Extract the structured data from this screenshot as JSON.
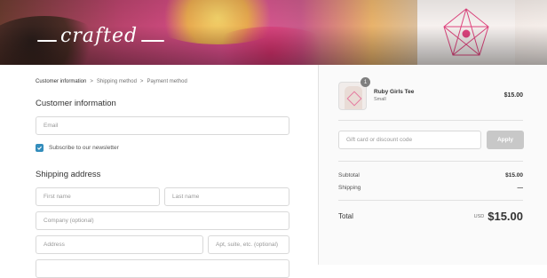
{
  "banner": {
    "logo_text": "crafted"
  },
  "breadcrumb": {
    "items": [
      "Customer information",
      "Shipping method",
      "Payment method"
    ],
    "separator": ">"
  },
  "customer": {
    "heading": "Customer information",
    "email_placeholder": "Email",
    "newsletter_label": "Subscribe to our newsletter",
    "newsletter_checked": true
  },
  "shipping": {
    "heading": "Shipping address",
    "first_name_placeholder": "First name",
    "last_name_placeholder": "Last name",
    "company_placeholder": "Company (optional)",
    "address_placeholder": "Address",
    "apt_placeholder": "Apt, suite, etc. (optional)"
  },
  "order": {
    "item": {
      "name": "Ruby Girls Tee",
      "variant": "Small",
      "price": "$15.00",
      "quantity": "1"
    },
    "gift_placeholder": "Gift card or discount code",
    "apply_label": "Apply",
    "subtotal_label": "Subtotal",
    "subtotal_value": "$15.00",
    "shipping_label": "Shipping",
    "shipping_value": "—",
    "total_label": "Total",
    "currency": "USD",
    "total_value": "$15.00"
  },
  "colors": {
    "accent": "#338dbc",
    "apply_disabled": "#c8c8c8"
  }
}
